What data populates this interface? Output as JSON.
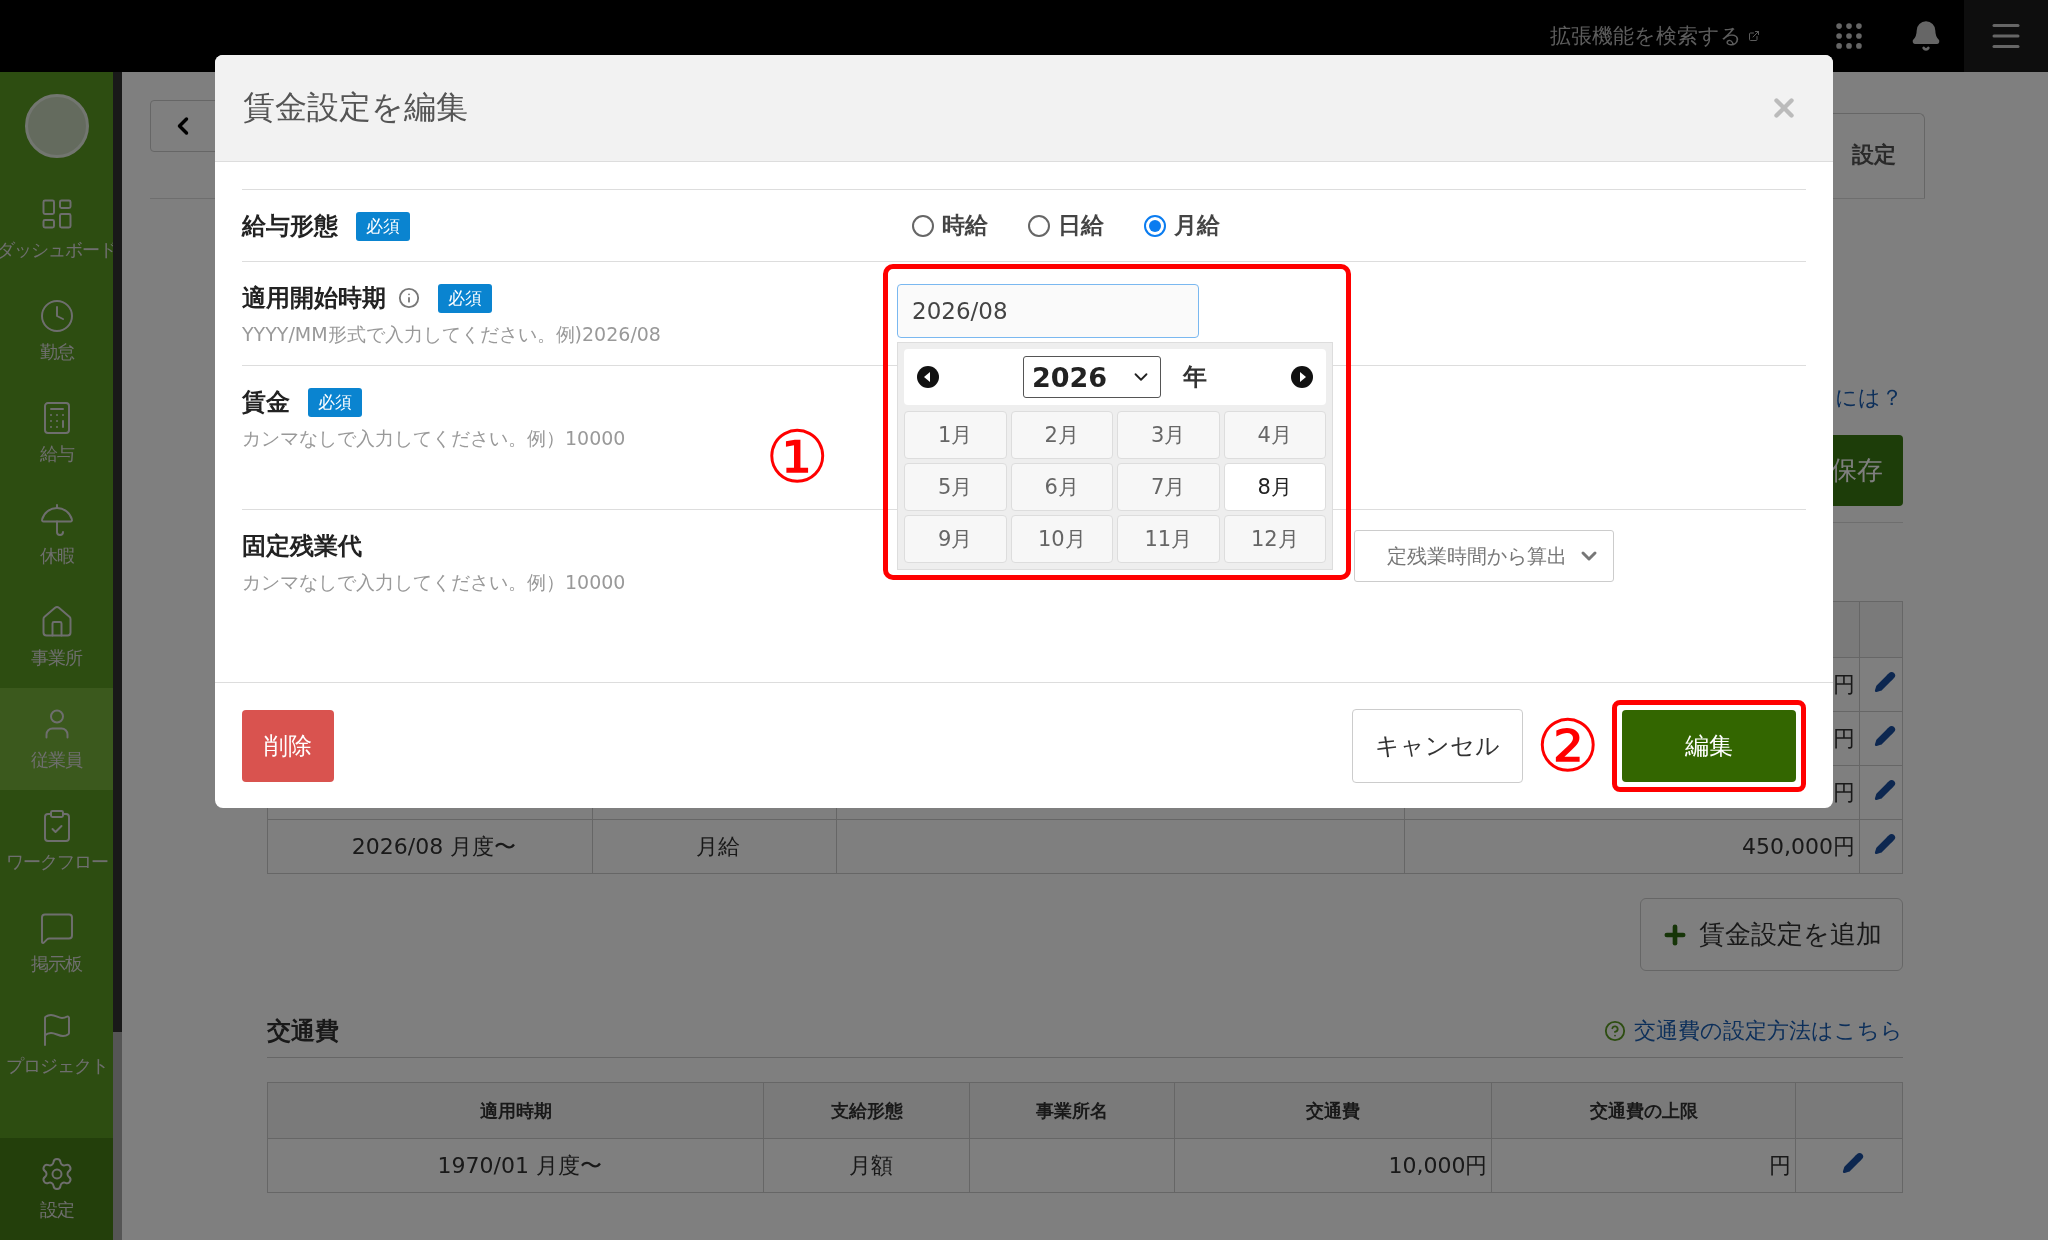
{
  "top_bar": {
    "extension_link": "拡張機能を検索する"
  },
  "sidebar": {
    "items": [
      {
        "kind": "dashboard",
        "label": "ダッシュボード",
        "selected": false
      },
      {
        "kind": "clock",
        "label": "勤怠",
        "selected": false
      },
      {
        "kind": "calculator",
        "label": "給与",
        "selected": false
      },
      {
        "kind": "umbrella",
        "label": "休暇",
        "selected": false
      },
      {
        "kind": "home",
        "label": "事業所",
        "selected": false
      },
      {
        "kind": "user",
        "label": "従業員",
        "selected": true
      },
      {
        "kind": "workflow",
        "label": "ワークフロー",
        "selected": false
      },
      {
        "kind": "board",
        "label": "掲示板",
        "selected": false
      },
      {
        "kind": "flag",
        "label": "プロジェクト",
        "selected": false
      },
      {
        "kind": "settings",
        "label": "設定",
        "selected": false
      }
    ]
  },
  "page": {
    "tab": "設定",
    "help_link": "には？",
    "save_button": "保存",
    "wage_table": {
      "rows": [
        {
          "amount": "円"
        },
        {
          "amount": "円"
        },
        {
          "amount": "円"
        },
        {
          "period": "2026/08 月度〜",
          "type": "月給",
          "amount": "450,000円"
        }
      ]
    },
    "add_button": "賃金設定を追加",
    "commute": {
      "title": "交通費",
      "help_link": "交通費の設定方法はこちら",
      "columns": [
        "適用時期",
        "支給形態",
        "事業所名",
        "交通費",
        "交通費の上限"
      ],
      "rows": [
        {
          "period": "1970/01 月度〜",
          "type": "月額",
          "fare": "10,000円",
          "limit": "円"
        }
      ]
    }
  },
  "modal": {
    "title": "賃金設定を編集",
    "fields": [
      {
        "kind": "radio",
        "label": "給与形態",
        "required_badge": "必須",
        "options": [
          {
            "label": "時給",
            "selected": false
          },
          {
            "label": "日給",
            "selected": false
          },
          {
            "label": "月給",
            "selected": true
          }
        ]
      },
      {
        "kind": "month",
        "label": "適用開始時期",
        "info": true,
        "required_badge": "必須",
        "hint": "YYYY/MM形式で入力してください。例)2026/08",
        "value": "2026/08",
        "picker": {
          "year": "2026",
          "year_suffix": "年",
          "months": [
            {
              "label": "1月",
              "selected": false
            },
            {
              "label": "2月",
              "selected": false
            },
            {
              "label": "3月",
              "selected": false
            },
            {
              "label": "4月",
              "selected": false
            },
            {
              "label": "5月",
              "selected": false
            },
            {
              "label": "6月",
              "selected": false
            },
            {
              "label": "7月",
              "selected": false
            },
            {
              "label": "8月",
              "selected": true
            },
            {
              "label": "9月",
              "selected": false
            },
            {
              "label": "10月",
              "selected": false
            },
            {
              "label": "11月",
              "selected": false
            },
            {
              "label": "12月",
              "selected": false
            }
          ]
        }
      },
      {
        "kind": "wage",
        "label": "賃金",
        "required_badge": "必須",
        "hint": "カンマなしで入力してください。例）10000"
      },
      {
        "kind": "overtime",
        "label": "固定残業代",
        "hint": "カンマなしで入力してください。例）10000",
        "select": "定残業時間から算出"
      }
    ],
    "buttons": {
      "delete": "削除",
      "cancel": "キャンセル",
      "submit": "編集"
    }
  },
  "annotations": [
    "①",
    "②"
  ]
}
